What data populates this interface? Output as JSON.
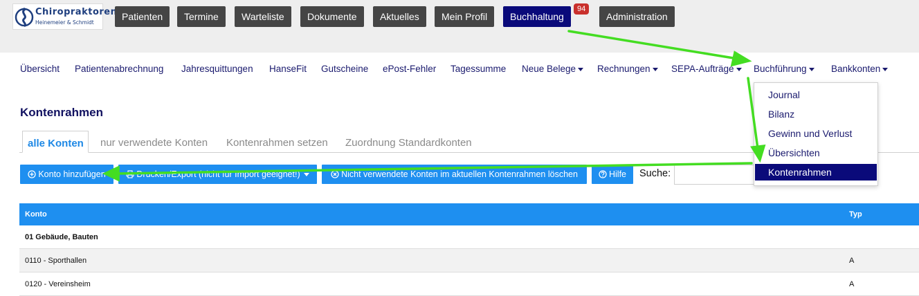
{
  "logo": {
    "title": "Chiropraktoren",
    "subtitle": "Heinemeier & Schmidt"
  },
  "main_nav": {
    "items": [
      {
        "label": "Patienten"
      },
      {
        "label": "Termine"
      },
      {
        "label": "Warteliste"
      },
      {
        "label": "Dokumente"
      },
      {
        "label": "Aktuelles"
      },
      {
        "label": "Mein Profil"
      },
      {
        "label": "Buchhaltung",
        "active": true
      },
      {
        "label": "Administration"
      }
    ],
    "badge": "94"
  },
  "sub_nav": {
    "items": [
      {
        "label": "Übersicht"
      },
      {
        "label": "Patientenabrechnung"
      },
      {
        "label": "Jahresquittungen"
      },
      {
        "label": "HanseFit"
      },
      {
        "label": "Gutscheine"
      },
      {
        "label": "ePost-Fehler"
      },
      {
        "label": "Tagessumme"
      },
      {
        "label": "Neue Belege",
        "dropdown": true
      },
      {
        "label": "Rechnungen",
        "dropdown": true
      },
      {
        "label": "SEPA-Aufträge",
        "dropdown": true
      },
      {
        "label": "Buchführung",
        "dropdown": true
      },
      {
        "label": "Bankkonten",
        "dropdown": true
      }
    ]
  },
  "dropdown": {
    "items": [
      {
        "label": "Journal"
      },
      {
        "label": "Bilanz"
      },
      {
        "label": "Gewinn und Verlust"
      },
      {
        "label": "Übersichten"
      },
      {
        "label": "Kontenrahmen",
        "active": true
      }
    ]
  },
  "page": {
    "title": "Kontenrahmen"
  },
  "tabs": [
    {
      "label": "alle Konten",
      "active": true
    },
    {
      "label": "nur verwendete Konten"
    },
    {
      "label": "Kontenrahmen setzen"
    },
    {
      "label": "Zuordnung Standardkonten"
    }
  ],
  "actions": {
    "add": "Konto hinzufügen",
    "print": "Drucken/Export (nicht für Import geeignet!)",
    "delete_unused": "Nicht verwendete Konten im aktuellen Kontenrahmen löschen",
    "help": "Hilfe",
    "search_label": "Suche:",
    "search_value": ""
  },
  "table": {
    "columns": [
      "Konto",
      "Typ"
    ],
    "rows": [
      {
        "konto": "01 Gebäude, Bauten",
        "typ": "",
        "group": true
      },
      {
        "konto": "0110 - Sporthallen",
        "typ": "A"
      },
      {
        "konto": "0120 - Vereinsheim",
        "typ": "A"
      }
    ]
  },
  "colors": {
    "nav_button": "#454545",
    "nav_active": "#0a0a7a",
    "accent_blue": "#1e8ff0",
    "link": "#1a1a6e",
    "badge": "#c9302c",
    "annotation_arrow": "#44dd22"
  },
  "icons": {
    "add": "plus-circle-icon",
    "print": "printer-icon",
    "delete": "x-circle-icon",
    "help": "question-circle-icon",
    "logo": "spine-logo-icon"
  }
}
